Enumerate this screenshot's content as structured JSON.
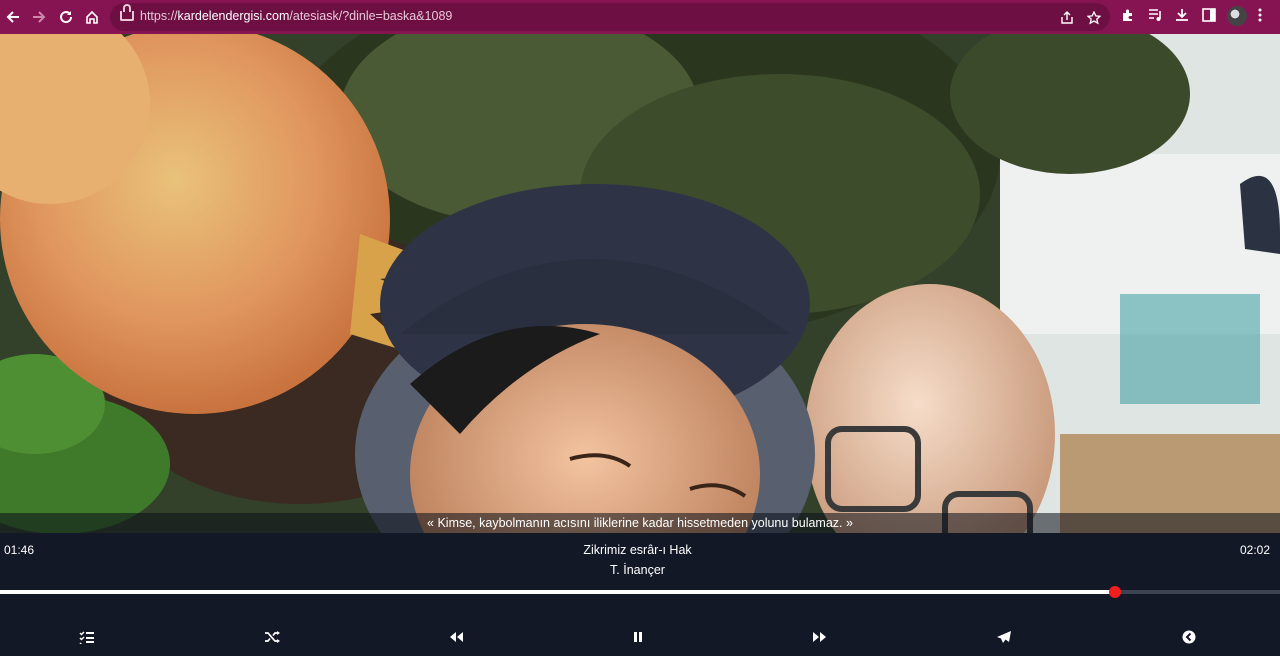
{
  "browser": {
    "url_prefix": "https://",
    "url_domain": "kardelendergisi.com",
    "url_path": "/atesiask/?dinle=baska&1089"
  },
  "player": {
    "quote": "« Kimse, kaybolmanın acısını iliklerine kadar hissetmeden yolunu bulamaz. »",
    "elapsed": "01:46",
    "duration": "02:02",
    "title": "Zikrimiz esrâr-ı Hak",
    "artist": "T. İnançer",
    "progress_fraction": 0.871
  },
  "colors": {
    "browser_bar": "#861452",
    "player_bg": "#121826",
    "progress_knob": "#f01e1e"
  }
}
